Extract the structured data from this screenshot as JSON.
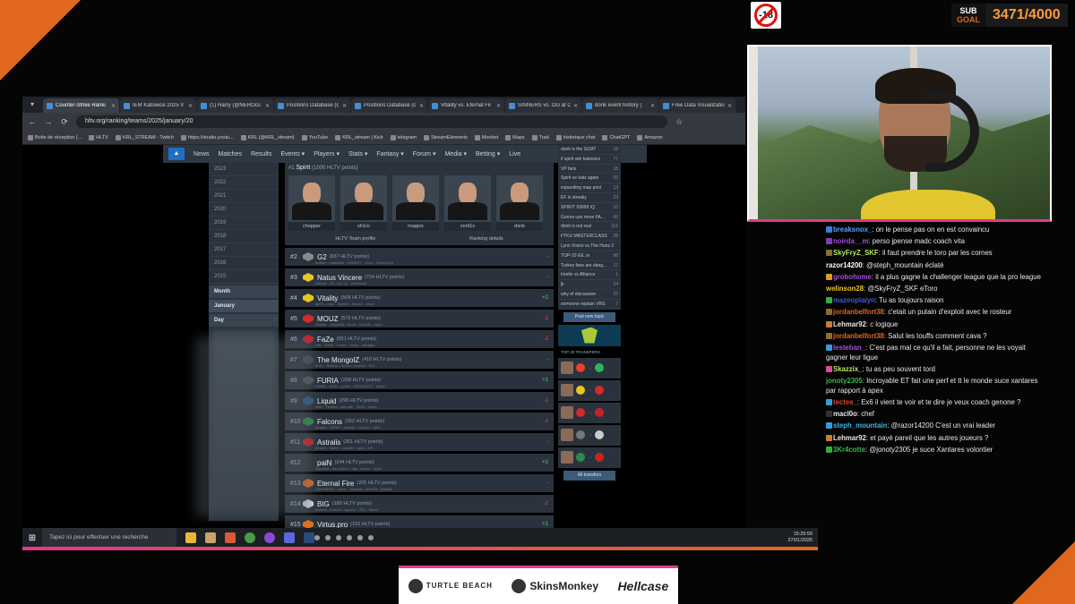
{
  "overlay": {
    "age_badge": "-18",
    "subgoal_label_1": "SUB",
    "subgoal_label_2": "GOAL",
    "subgoal_count": "3471/4000"
  },
  "browser": {
    "tabs": [
      {
        "title": "Counter-Strike Ranki",
        "active": true
      },
      {
        "title": "IEM Katowice 2025 V",
        "active": false
      },
      {
        "title": "(1) Harry (@NEROcs",
        "active": false
      },
      {
        "title": "Positions Database (c",
        "active": false
      },
      {
        "title": "Positions Database (c",
        "active": false
      },
      {
        "title": "Vitality vs. Eternal Fir",
        "active": false
      },
      {
        "title": "SINNERS vs. OG at C",
        "active": false
      },
      {
        "title": "donk event history |",
        "active": false
      },
      {
        "title": "Free Data Visualizatio",
        "active": false
      }
    ],
    "url": "hltv.org/ranking/teams/2025/january/20",
    "bookmarks": [
      "Boite de réception (...",
      "HLTV",
      "KRL_STREAM - Twitch",
      "https://studio.youtu...",
      "KRL (@KRL_stream)",
      "YouTube",
      "KRL_stream | Kick",
      "telegram",
      "StreamElements",
      "Moobot",
      "Maps",
      "Trad",
      "historique chat",
      "ChatGPT",
      "Amazon"
    ]
  },
  "hltv": {
    "nav": [
      "News",
      "Matches",
      "Results",
      "Events ▾",
      "Players ▾",
      "Stats ▾",
      "Fantasy ▾",
      "Forum ▾",
      "Media ▾",
      "Betting ▾",
      "Live"
    ],
    "years": [
      "2023",
      "2022",
      "2021",
      "2020",
      "2019",
      "2018",
      "2017",
      "2016",
      "2015"
    ],
    "month_header": "Month",
    "month_selected": "January",
    "day_header": "Day",
    "team1": {
      "rank": "#1",
      "name": "Spirit",
      "points": "(1000 HLTV points)",
      "players": [
        "chopper",
        "sh1ro",
        "magixx",
        "zont1x",
        "donk"
      ],
      "profile_link": "HLTV Team profile",
      "details_link": "Ranking details"
    },
    "teams": [
      {
        "rank": "#2",
        "name": "G2",
        "points": "(837 HLTV points)",
        "roster": "huNter - malbsMd - m0NESY - Snax - HeavyGod",
        "change": "-",
        "dir": "neu",
        "color": "#8a8a8a"
      },
      {
        "rank": "#3",
        "name": "Natus Vincere",
        "points": "(724 HLTV points)",
        "roster": "Aleksib - iM - b1t - jL - w0nderful",
        "change": "-",
        "dir": "neu",
        "color": "#e8c520"
      },
      {
        "rank": "#4",
        "name": "Vitality",
        "points": "(568 HLTV points)",
        "roster": "apEX - ropz - ZywOo - flameZ - mezii",
        "change": "+2",
        "dir": "pos",
        "color": "#e8c520"
      },
      {
        "rank": "#5",
        "name": "MOUZ",
        "points": "(572 HLTV points)",
        "roster": "Brollan - Jimpphat - torzsi - xertioN - Spinx",
        "change": "-1",
        "dir": "neg",
        "color": "#d42a2a"
      },
      {
        "rank": "#6",
        "name": "FaZe",
        "points": "(551 HLTV points)",
        "roster": "rain - EliGE - frozen - broky - karrigan",
        "change": "-1",
        "dir": "neg",
        "color": "#c8202a"
      },
      {
        "rank": "#7",
        "name": "The MongolZ",
        "points": "(410 HLTV points)",
        "roster": "bLitz - Techno - Senzu - mzinho - 910",
        "change": "-",
        "dir": "neu",
        "color": "#4a4a4a"
      },
      {
        "rank": "#8",
        "name": "FURIA",
        "points": "(298 HLTV points)",
        "roster": "FalleN - chelo - yuurih - KSCERATO - skullz",
        "change": "+1",
        "dir": "pos",
        "color": "#555"
      },
      {
        "rank": "#9",
        "name": "Liquid",
        "points": "(295 HLTV points)",
        "roster": "NAF - Twistzz - ultimate - NertZ - siuhy",
        "change": "-1",
        "dir": "neg",
        "color": "#2a5a8a"
      },
      {
        "rank": "#10",
        "name": "Falcons",
        "points": "(262 HLTV points)",
        "roster": "Magisk - TeSeS - degster - kyxsan - NiKo",
        "change": "-1",
        "dir": "neg",
        "color": "#2a8a4a"
      },
      {
        "rank": "#11",
        "name": "Astralis",
        "points": "(261 HLTV points)",
        "roster": "device - Staehr - cadiaN - jabbi - br0",
        "change": "-",
        "dir": "neu",
        "color": "#c22"
      },
      {
        "rank": "#12",
        "name": "paiN",
        "points": "(244 HLTV points)",
        "roster": "biguzera - dav1deuS - nqz - kauez - snow",
        "change": "+2",
        "dir": "pos",
        "color": "#333"
      },
      {
        "rank": "#13",
        "name": "Eternal Fire",
        "points": "(205 HLTV points)",
        "roster": "XANTARES - woxic - Wicadia - MAJ3R - jottAAA",
        "change": "-",
        "dir": "neu",
        "color": "#e06a20"
      },
      {
        "rank": "#14",
        "name": "BIG",
        "points": "(180 HLTV points)",
        "roster": "tabseN - Krimbo - syrsoN - JDC - faveN",
        "change": "-2",
        "dir": "neg",
        "color": "#ddd"
      },
      {
        "rank": "#15",
        "name": "Virtus.pro",
        "points": "(153 HLTV points)",
        "roster": "electroNic - FL1T - fame - ICY - Perfecto",
        "change": "+1",
        "dir": "pos",
        "color": "#e07020"
      }
    ],
    "forum": [
      {
        "t": "donk is the GOAT",
        "n": "18"
      },
      {
        "t": "if spirit win katowice",
        "n": "77"
      },
      {
        "t": "VP fans",
        "n": "18"
      },
      {
        "t": "Spirit ez katz again",
        "n": "55"
      },
      {
        "t": "expanding map pool",
        "n": "13"
      },
      {
        "t": "EF is streaky",
        "n": "23"
      },
      {
        "t": "SPIRIT 99999 IQ",
        "n": "10"
      },
      {
        "t": "Gonna use more FA...",
        "n": "43"
      },
      {
        "t": "donk is not real",
        "n": "116"
      },
      {
        "t": "FTKU MASTERCLASS",
        "n": "28"
      },
      {
        "t": "Lynn Vision vs The Huns 2",
        "n": ""
      },
      {
        "t": "TOP-10 IGL m",
        "n": "98"
      },
      {
        "t": "Turkey fans are dang...",
        "n": "17"
      },
      {
        "t": "Imolio vs Alliance",
        "n": "1"
      },
      {
        "t": "jk",
        "n": "24"
      },
      {
        "t": "why ef discussion",
        "n": "37"
      },
      {
        "t": "someone explain VRS",
        "n": "7"
      }
    ],
    "post_button": "Post new topic",
    "transfers_title": "TOP 20 TRANSFERS",
    "transfers": [
      {
        "from": "#e8402a",
        "to": "#2ab85a"
      },
      {
        "from": "#e8c520",
        "to": "#d42a2a"
      },
      {
        "from": "#d42a2a",
        "to": "#c8202a"
      },
      {
        "from": "#777",
        "to": "#ccc"
      },
      {
        "from": "#2a8a4a",
        "to": "#c22"
      }
    ],
    "all_transfers": "All transfers"
  },
  "taskbar": {
    "search": "Tapez ici pour effectuer une recherche",
    "time": "15:29:59",
    "date": "27/01/2025"
  },
  "chat": [
    {
      "user": "breaksnox_",
      "msg": "on le pense pas on en est convaincu",
      "color": "#5b9cff",
      "badge": "#3a7bd5"
    },
    {
      "user": "noirda__m",
      "msg": "perso jpense madc coach vita",
      "color": "#a34fd8",
      "badge": "#7b3fb5"
    },
    {
      "user": "SkyFryZ_SKF",
      "msg": "il faut prendre le toro par les cornes",
      "color": "#b6e55c",
      "badge": "#8b6b3a"
    },
    {
      "user": "razor14200",
      "msg": "@steph_mountain éclaté",
      "color": "#ffffff",
      "badge": ""
    },
    {
      "user": "grobohome",
      "msg": "il a plus gagne la challenger league que la pro league",
      "color": "#a34fd8",
      "badge": "#d4a020"
    },
    {
      "user": "welinson28",
      "msg": "@SkyFryZ_SKF eToro",
      "color": "#e8c520",
      "badge": ""
    },
    {
      "user": "mazeoplaiyn",
      "msg": "Tu as toujours raison",
      "color": "#3a5ad8",
      "badge": "#3aa84a"
    },
    {
      "user": "jordanbelfort38",
      "msg": "c'etait un putain d'exploit avec le rosteur",
      "color": "#e0671d",
      "badge": "#8b6b3a"
    },
    {
      "user": "Lehmar92",
      "msg": "c logique",
      "color": "#e8e8e8",
      "badge": "#c87a3a"
    },
    {
      "user": "jordanbelfort38",
      "msg": "Salut les touffs comment cava ?",
      "color": "#e0671d",
      "badge": "#8b6b3a"
    },
    {
      "user": "lesteban_",
      "msg": "C'est pas mal ce qu'il a fait, personne ne les voyait gagner leur ligue",
      "color": "#a34fd8",
      "badge": "#3a9ad8"
    },
    {
      "user": "Skazzix_",
      "msg": "tu as peu souvent tord",
      "color": "#b6e55c",
      "badge": "#d84a9a"
    },
    {
      "user": "jonoty2305",
      "msg": "Incroyable ET fait une perf et tt le monde suce xantares par rapport à apex",
      "color": "#3ab84a",
      "badge": ""
    },
    {
      "user": "tectes_",
      "msg": "Ex6 il vient te voir et te dire je veux coach genone ?",
      "color": "#e8402a",
      "badge": "#3a9ad8"
    },
    {
      "user": "macl0o",
      "msg": "chef",
      "color": "#e8e8e8",
      "badge": "#333"
    },
    {
      "user": "steph_mountain",
      "msg": "@razor14200 C'est un vrai leader",
      "color": "#3ab8e8",
      "badge": "#3a9ad8"
    },
    {
      "user": "Lehmar92",
      "msg": "et payé pareil que les autres joueurs ?",
      "color": "#e8e8e8",
      "badge": "#c87a3a"
    },
    {
      "user": "3Kr4cotte",
      "msg": "@jonoty2305 je suce Xantares volontier",
      "color": "#3ab84a",
      "badge": "#3aa84a"
    }
  ],
  "sponsors": [
    "TURTLE BEACH",
    "SkinsMonkey",
    "Hellcase"
  ]
}
